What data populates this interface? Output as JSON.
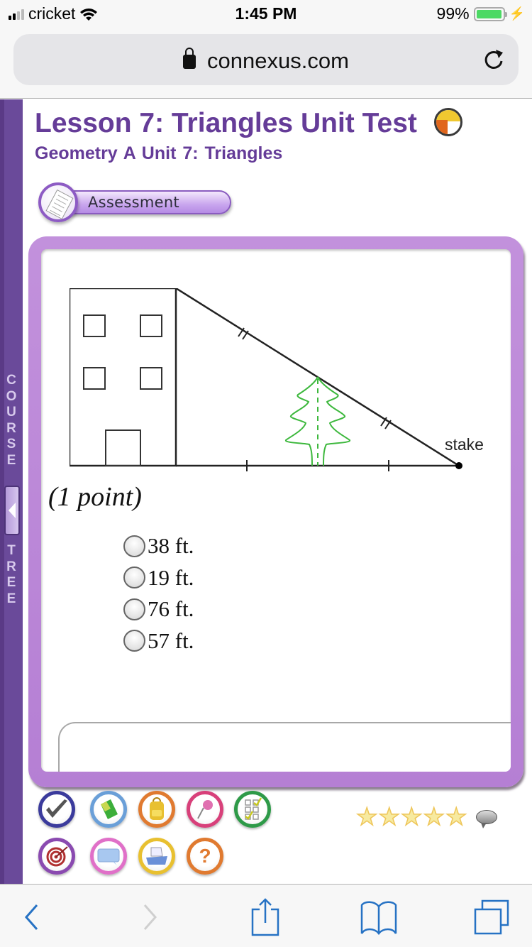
{
  "status_bar": {
    "carrier": "cricket",
    "time": "1:45 PM",
    "battery": "99%",
    "battery_level_percent": 99
  },
  "browser": {
    "url": "connexus.com",
    "icons": {
      "lock": "lock-icon",
      "reload": "reload-icon"
    }
  },
  "course_tree": {
    "word_top": "COURSE",
    "word_bottom": "TREE",
    "toggle_icon": "collapse-arrow-icon"
  },
  "header": {
    "title": "Lesson 7: Triangles Unit Test",
    "title_icon": "connexus-logo-icon",
    "subtitle": "Geometry A  Unit 7: Triangles",
    "badge_label": "Assessment",
    "badge_icon": "document-icon"
  },
  "question": {
    "diagram": {
      "label": "stake",
      "description": "Building with triangle from roof to stake; tree at midpoint of hypotenuse; equal-length tick marks on hypotenuse and base"
    },
    "points": "(1 point)",
    "options": [
      {
        "label": "38 ft.",
        "selected": false
      },
      {
        "label": "19 ft.",
        "selected": false
      },
      {
        "label": "76 ft.",
        "selected": false
      },
      {
        "label": "57 ft.",
        "selected": false
      }
    ]
  },
  "tools": {
    "row1": [
      {
        "name": "check-tool",
        "icon": "checkmark-icon",
        "color": "#3b3b9c"
      },
      {
        "name": "book-tool",
        "icon": "book-icon",
        "color": "#6a9fd8"
      },
      {
        "name": "backpack-tool",
        "icon": "backpack-icon",
        "color": "#e07a30"
      },
      {
        "name": "pin-tool",
        "icon": "pushpin-icon",
        "color": "#d8407a"
      },
      {
        "name": "checklist-tool",
        "icon": "checklist-icon",
        "color": "#2e9a48"
      }
    ],
    "row2": [
      {
        "name": "target-tool",
        "icon": "target-icon",
        "color": "#8a4ab0"
      },
      {
        "name": "message-tool",
        "icon": "message-icon",
        "color": "#e070c8"
      },
      {
        "name": "print-tool",
        "icon": "printer-icon",
        "color": "#e8c030"
      },
      {
        "name": "help-tool",
        "icon": "help-icon",
        "color": "#e07a30"
      }
    ],
    "help_glyph": "?"
  },
  "rating": {
    "stars_total": 5,
    "stars_filled": 0,
    "comment_icon": "comment-bubble-icon"
  },
  "toolbar": {
    "icons": [
      "back-icon",
      "forward-icon",
      "share-icon",
      "bookmarks-icon",
      "tabs-icon"
    ]
  }
}
